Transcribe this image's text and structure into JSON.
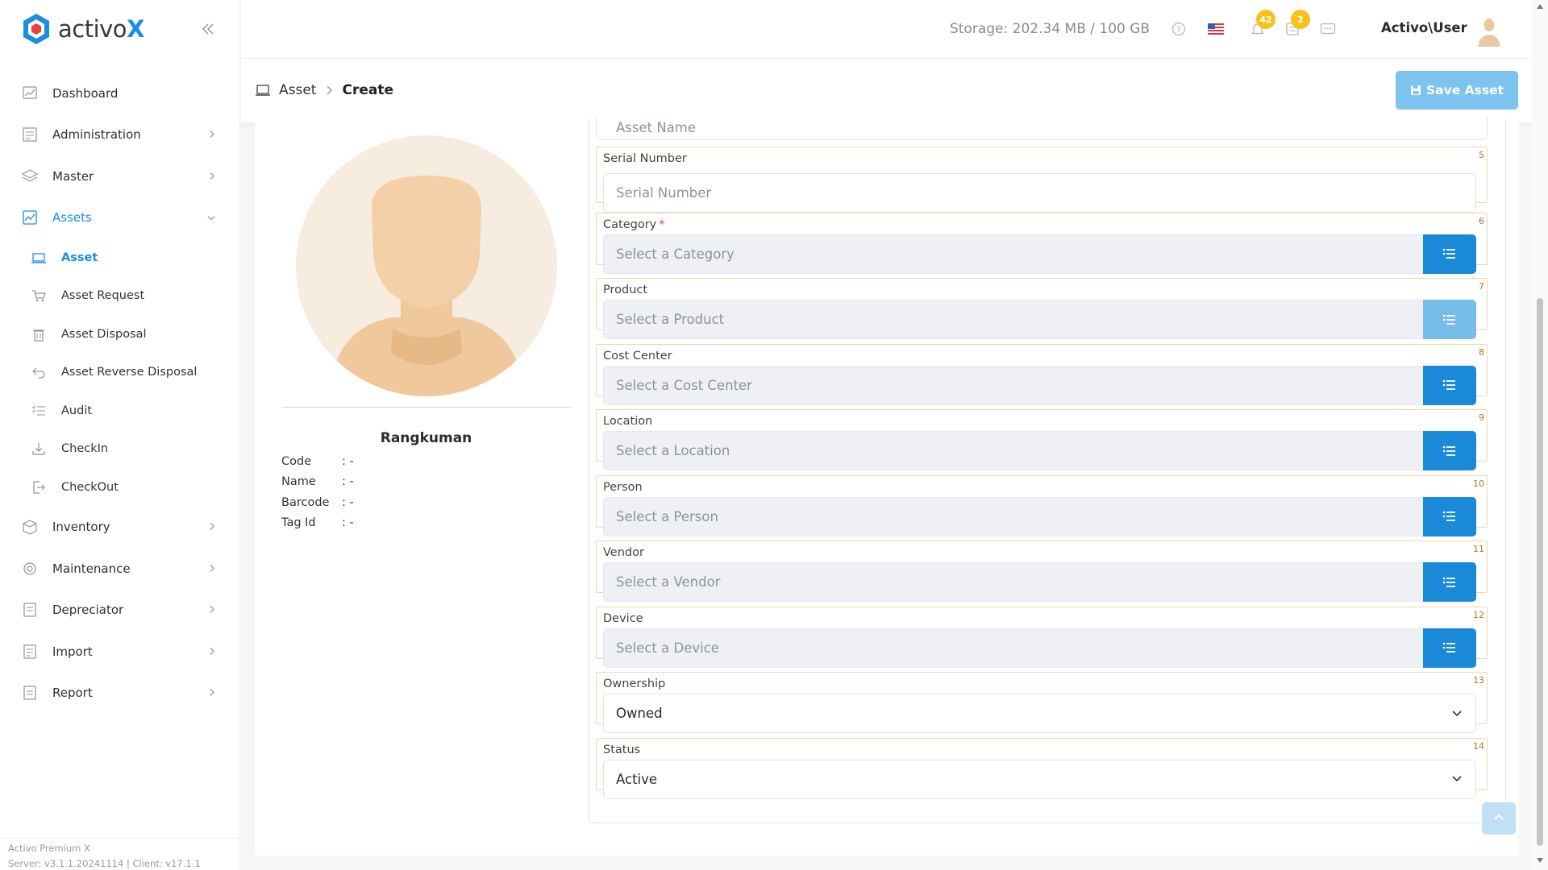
{
  "app": {
    "logo_text": "activo",
    "logo_text_accent": "X"
  },
  "sidebar": {
    "items": [
      {
        "label": "Dashboard",
        "icon": "dashboard-icon",
        "chevron": false
      },
      {
        "label": "Administration",
        "icon": "administration-icon",
        "chevron": true
      },
      {
        "label": "Master",
        "icon": "layers-icon",
        "chevron": true
      },
      {
        "label": "Assets",
        "icon": "assets-icon",
        "chevron": true,
        "expanded": true,
        "active": true
      },
      {
        "label": "Inventory",
        "icon": "inventory-icon",
        "chevron": true
      },
      {
        "label": "Maintenance",
        "icon": "maintenance-icon",
        "chevron": true
      },
      {
        "label": "Depreciator",
        "icon": "depreciator-icon",
        "chevron": true
      },
      {
        "label": "Import",
        "icon": "import-icon",
        "chevron": true
      },
      {
        "label": "Report",
        "icon": "report-icon",
        "chevron": true
      }
    ],
    "asset_subitems": [
      {
        "label": "Asset",
        "icon": "laptop-icon",
        "active": true
      },
      {
        "label": "Asset Request",
        "icon": "cart-icon"
      },
      {
        "label": "Asset Disposal",
        "icon": "trash-icon"
      },
      {
        "label": "Asset Reverse Disposal",
        "icon": "undo-icon"
      },
      {
        "label": "Audit",
        "icon": "checklist-icon"
      },
      {
        "label": "CheckIn",
        "icon": "download-icon"
      },
      {
        "label": "CheckOut",
        "icon": "logout-icon"
      }
    ],
    "footer": {
      "line1": "Activo Premium X",
      "line2": "Server: v3.1.1.20241114 | Client: v17.1.1"
    }
  },
  "header": {
    "storage": "Storage: 202.34 MB / 100 GB",
    "notification_count": "42",
    "task_count": "2",
    "username": "Activo\\User",
    "icons": [
      "help-icon",
      "flag-us-icon",
      "bell-icon",
      "tasks-icon",
      "chat-icon"
    ]
  },
  "breadcrumb": {
    "root": "Asset",
    "current": "Create"
  },
  "toolbar": {
    "save_label": "Save Asset"
  },
  "profile": {
    "name": "Rangkuman",
    "rows": [
      {
        "key": "Code",
        "value": ": -"
      },
      {
        "key": "Name",
        "value": ": -"
      },
      {
        "key": "Barcode",
        "value": ": -"
      },
      {
        "key": "Tag Id",
        "value": ": -"
      }
    ]
  },
  "form": {
    "asset_name_placeholder": "Asset Name",
    "fields": [
      {
        "label": "Serial Number",
        "num": "5",
        "type": "text",
        "placeholder": "Serial Number"
      },
      {
        "label": "Category",
        "num": "6",
        "type": "select",
        "placeholder": "Select a Category",
        "required": true
      },
      {
        "label": "Product",
        "num": "7",
        "type": "select",
        "placeholder": "Select a Product",
        "disabled_btn": true
      },
      {
        "label": "Cost Center",
        "num": "8",
        "type": "select",
        "placeholder": "Select a Cost Center"
      },
      {
        "label": "Location",
        "num": "9",
        "type": "select",
        "placeholder": "Select a Location"
      },
      {
        "label": "Person",
        "num": "10",
        "type": "select",
        "placeholder": "Select a Person"
      },
      {
        "label": "Vendor",
        "num": "11",
        "type": "select",
        "placeholder": "Select a Vendor"
      },
      {
        "label": "Device",
        "num": "12",
        "type": "select",
        "placeholder": "Select a Device"
      },
      {
        "label": "Ownership",
        "num": "13",
        "type": "dropdown",
        "value": "Owned"
      },
      {
        "label": "Status",
        "num": "14",
        "type": "dropdown",
        "value": "Active"
      }
    ]
  },
  "colors": {
    "accent": "#1a8ad8",
    "accent_light": "#7cc4ee",
    "badge": "#f7c21a",
    "field_border": "#f1d7a4"
  }
}
